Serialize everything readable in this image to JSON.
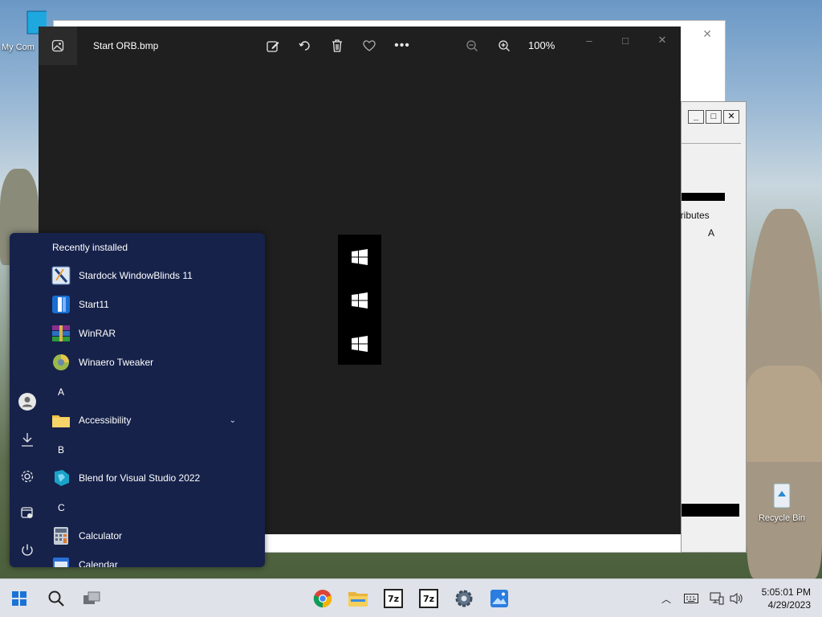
{
  "desktop": {
    "icons": [
      {
        "label": "My Com"
      },
      {
        "label": "Recycle Bin"
      }
    ]
  },
  "background_window": {
    "partial_text": "ttributes",
    "attr_value": "A"
  },
  "photos": {
    "file_name": "Start ORB.bmp",
    "zoom": "100%"
  },
  "start_menu": {
    "section_title": "Recently installed",
    "recent": [
      {
        "label": "Stardock WindowBlinds 11"
      },
      {
        "label": "Start11"
      },
      {
        "label": "WinRAR"
      },
      {
        "label": "Winaero Tweaker"
      }
    ],
    "groups": [
      {
        "letter": "A",
        "items": [
          {
            "label": "Accessibility"
          }
        ]
      },
      {
        "letter": "B",
        "items": [
          {
            "label": "Blend for Visual Studio 2022"
          }
        ]
      },
      {
        "letter": "C",
        "items": [
          {
            "label": "Calculator"
          },
          {
            "label": "Calendar"
          }
        ]
      }
    ]
  },
  "taskbar": {
    "time": "5:05:01 PM",
    "date": "4/29/2023"
  }
}
